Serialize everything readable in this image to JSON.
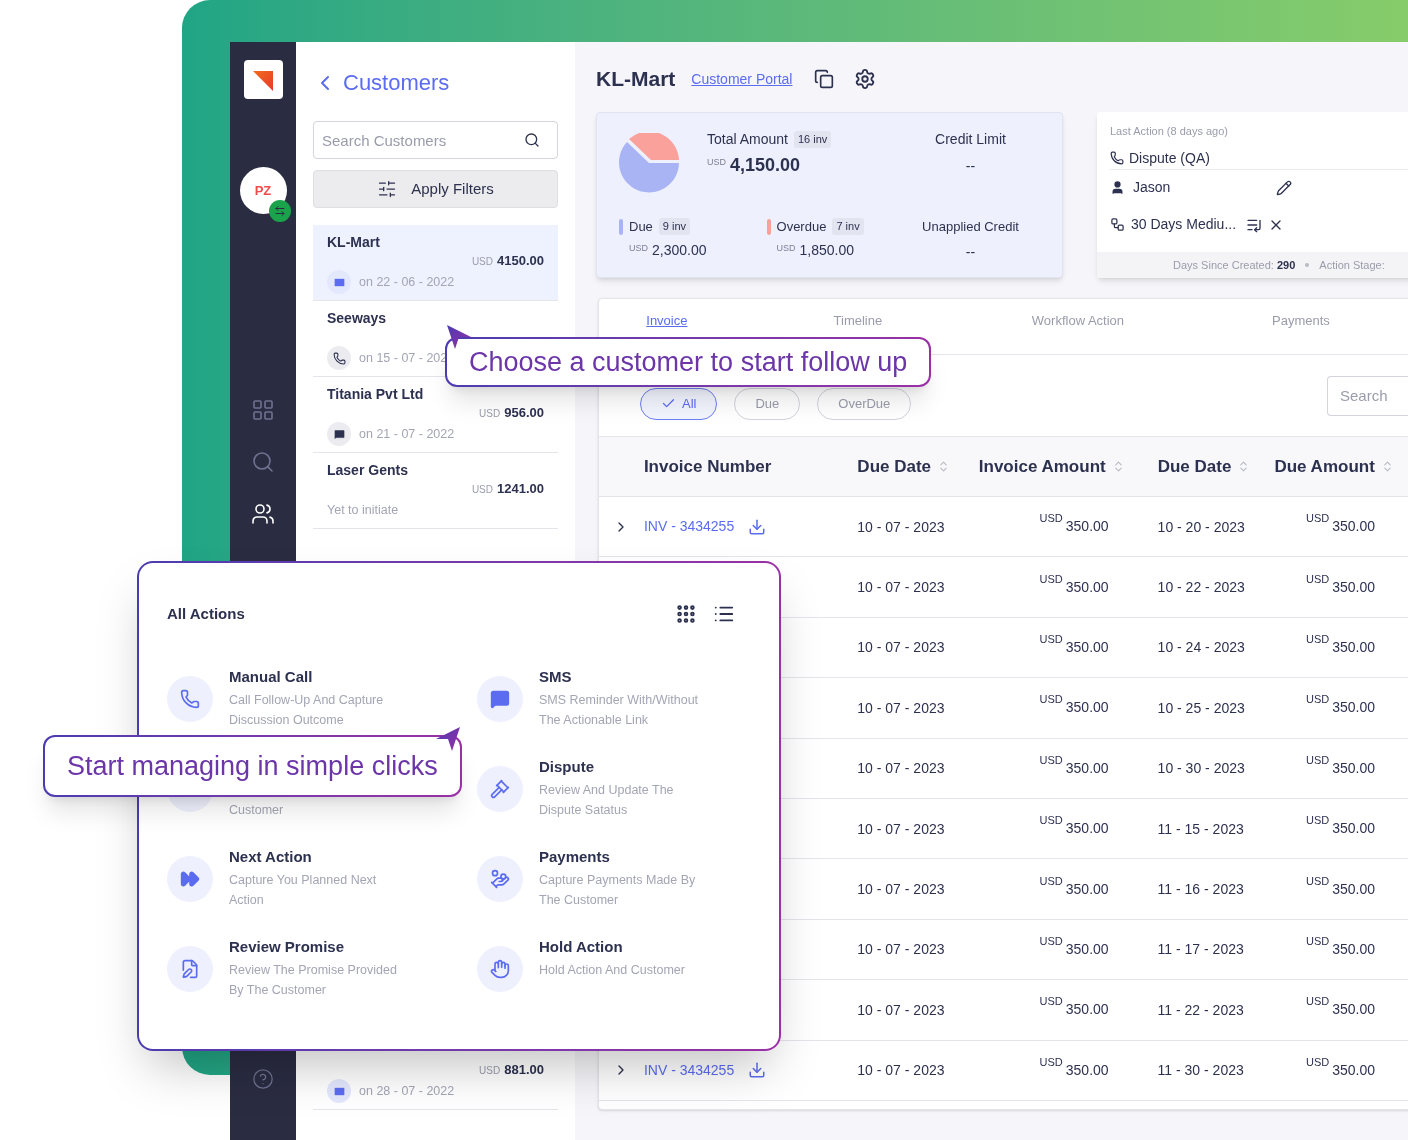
{
  "sidebar": {
    "avatar_initials": "PZ",
    "nav": [
      {
        "selected": false
      },
      {
        "selected": false
      },
      {
        "selected": true
      }
    ]
  },
  "customers_panel": {
    "title": "Customers",
    "search": {
      "placeholder": "Search Customers"
    },
    "filter_button": "Apply Filters",
    "customers": [
      {
        "name": "KL-Mart",
        "currency": "USD",
        "amount": "4150.00",
        "kind": "email",
        "status": "on 22 - 06 - 2022",
        "selected": true
      },
      {
        "name": "Seeways",
        "kind": "call",
        "status": "on 15 - 07 - 202",
        "selected": false
      },
      {
        "name": "Titania Pvt Ltd",
        "currency": "USD",
        "amount": "956.00",
        "kind": "chat",
        "status": "on 21 - 07 - 2022",
        "selected": false
      },
      {
        "name": "Laser Gents",
        "currency": "USD",
        "amount": "1241.00",
        "kind": "none",
        "status": "Yet to initiate",
        "selected": false
      }
    ],
    "bottom_customer": {
      "currency": "USD",
      "amount": "881.00",
      "kind": "email",
      "status": "on 28 - 07 - 2022",
      "selected": false
    }
  },
  "header": {
    "customer": "KL-Mart",
    "portal_link": "Customer Portal"
  },
  "summary": {
    "total_label": "Total Amount",
    "total_count": "16 inv",
    "currency": "USD",
    "total": "4,150.00",
    "credit_limit_label": "Credit Limit",
    "credit_limit": "--",
    "parts": [
      {
        "label": "Due",
        "count": "9 inv",
        "currency": "USD",
        "amount": "2,300.00",
        "color": "#a9b4f5"
      },
      {
        "label": "Overdue",
        "count": "7 inv",
        "currency": "USD",
        "amount": "1,850.00",
        "color": "#f9a19a"
      }
    ],
    "unapplied_label": "Unapplied Credit",
    "unapplied": "--"
  },
  "last_action": {
    "heading": "Last Action (8 days ago)",
    "action": "Dispute (QA)",
    "owner": "Jason",
    "workflow": "30 Days Mediu...",
    "footer": [
      {
        "label": "Days Since Created:",
        "value": "290"
      },
      {
        "label": "Action Stage:"
      }
    ]
  },
  "tabs": [
    {
      "label": "Invoice",
      "selected": true
    },
    {
      "label": "Timeline",
      "selected": false
    },
    {
      "label": "Workflow Action",
      "selected": false
    },
    {
      "label": "Payments",
      "selected": false
    }
  ],
  "filters": [
    {
      "label": "All",
      "selected": true
    },
    {
      "label": "Due",
      "selected": false
    },
    {
      "label": "OverDue",
      "selected": false
    }
  ],
  "table_search": {
    "placeholder": "Search"
  },
  "table": {
    "columns": [
      {
        "label": "Invoice Number",
        "sortable": false
      },
      {
        "label": "Due Date",
        "sortable": true
      },
      {
        "label": "Invoice Amount",
        "sortable": true
      },
      {
        "label": "Due Date",
        "sortable": true
      },
      {
        "label": "Due Amount",
        "sortable": true
      }
    ],
    "rows": [
      {
        "invoice": "INV - 3434255",
        "date": "10 - 07 - 2023",
        "currency": "USD",
        "amount": "350.00",
        "due_date": "10 - 20 - 2023",
        "due_currency": "USD",
        "due_amount": "350.00"
      },
      {
        "date": "10 - 07 - 2023",
        "currency": "USD",
        "amount": "350.00",
        "due_date": "10 - 22 - 2023",
        "due_currency": "USD",
        "due_amount": "350.00"
      },
      {
        "date": "10 - 07 - 2023",
        "currency": "USD",
        "amount": "350.00",
        "due_date": "10 - 24 - 2023",
        "due_currency": "USD",
        "due_amount": "350.00"
      },
      {
        "date": "10 - 07 - 2023",
        "currency": "USD",
        "amount": "350.00",
        "due_date": "10 - 25 - 2023",
        "due_currency": "USD",
        "due_amount": "350.00"
      },
      {
        "date": "10 - 07 - 2023",
        "currency": "USD",
        "amount": "350.00",
        "due_date": "10 - 30 - 2023",
        "due_currency": "USD",
        "due_amount": "350.00"
      },
      {
        "date": "10 - 07 - 2023",
        "currency": "USD",
        "amount": "350.00",
        "due_date": "11 - 15 - 2023",
        "due_currency": "USD",
        "due_amount": "350.00"
      },
      {
        "date": "10 - 07 - 2023",
        "currency": "USD",
        "amount": "350.00",
        "due_date": "11 - 16 - 2023",
        "due_currency": "USD",
        "due_amount": "350.00"
      },
      {
        "date": "10 - 07 - 2023",
        "currency": "USD",
        "amount": "350.00",
        "due_date": "11 - 17 - 2023",
        "due_currency": "USD",
        "due_amount": "350.00"
      },
      {
        "date": "10 - 07 - 2023",
        "currency": "USD",
        "amount": "350.00",
        "due_date": "11 - 22 - 2023",
        "due_currency": "USD",
        "due_amount": "350.00"
      },
      {
        "invoice": "INV - 3434255",
        "date": "10 - 07 - 2023",
        "currency": "USD",
        "amount": "350.00",
        "due_date": "11 - 30 - 2023",
        "due_currency": "USD",
        "due_amount": "350.00"
      }
    ]
  },
  "actions_card": {
    "title": "All Actions",
    "items": [
      {
        "kind": "call",
        "title": "Manual Call",
        "description": "Call Follow-Up And Capture Discussion Outcome"
      },
      {
        "kind": "covered",
        "description": "Customer"
      },
      {
        "kind": "next",
        "title": "Next Action",
        "description": "Capture You Planned Next Action"
      },
      {
        "kind": "promise",
        "title": "Review Promise",
        "description": "Review The Promise Provided By The Customer"
      },
      {
        "kind": "sms",
        "title": "SMS",
        "description": "SMS Reminder With/Without The Actionable Link"
      },
      {
        "kind": "dispute",
        "title": "Dispute",
        "description": "Review And Update The Dispute Satatus"
      },
      {
        "kind": "payments",
        "title": "Payments",
        "description": "Capture Payments Made By The Customer"
      },
      {
        "kind": "hold",
        "title": "Hold Action",
        "description": "Hold Action And Customer"
      }
    ]
  },
  "callouts": [
    {
      "text": "Choose a customer to start follow up"
    },
    {
      "text": "Start managing in simple clicks"
    }
  ]
}
